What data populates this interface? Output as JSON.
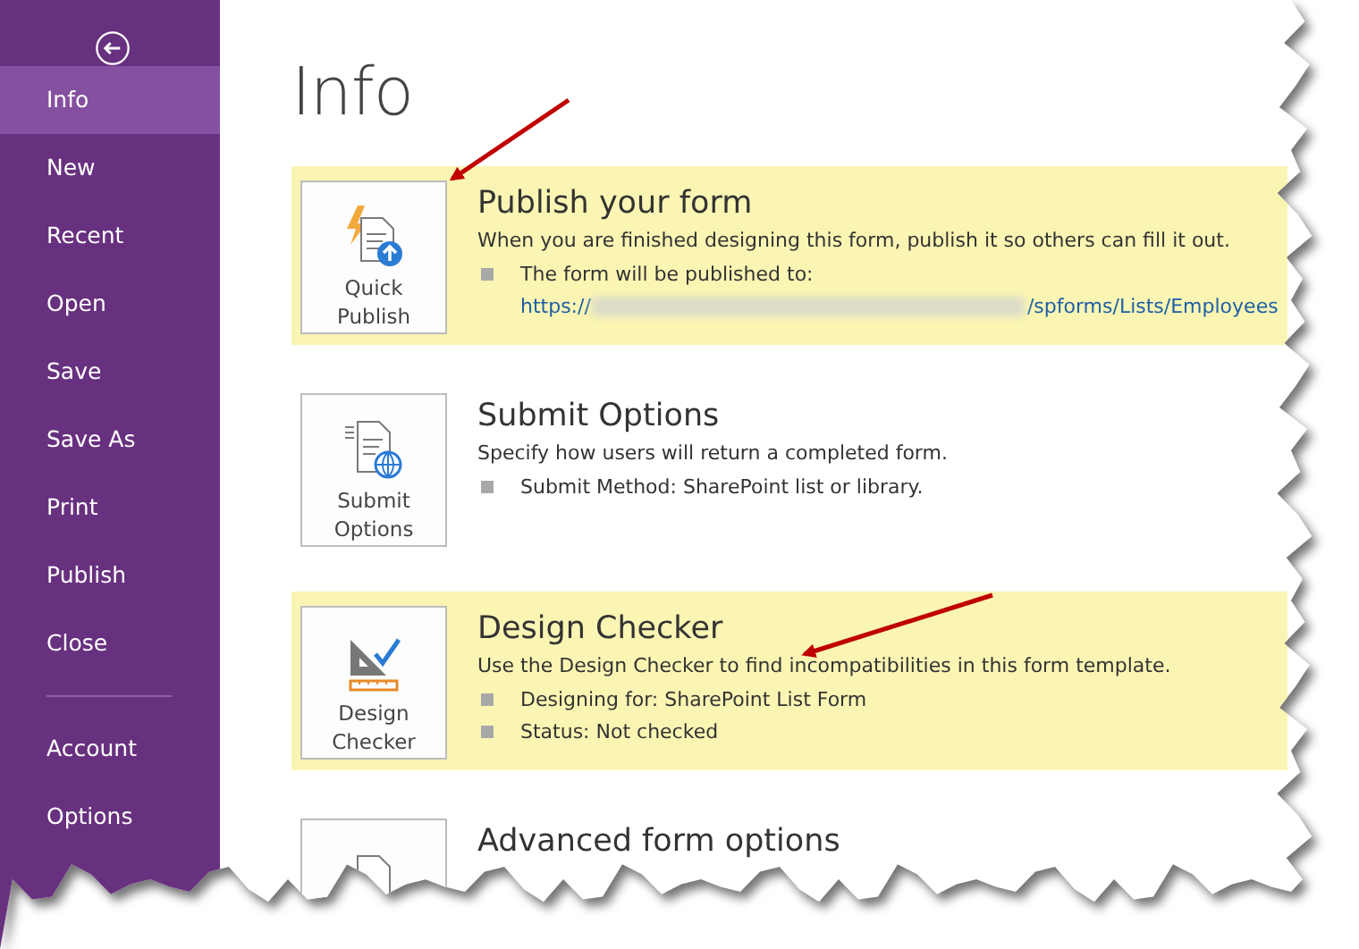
{
  "sidebar": {
    "items": [
      {
        "label": "Info",
        "selected": true
      },
      {
        "label": "New",
        "selected": false
      },
      {
        "label": "Recent",
        "selected": false
      },
      {
        "label": "Open",
        "selected": false
      },
      {
        "label": "Save",
        "selected": false
      },
      {
        "label": "Save As",
        "selected": false
      },
      {
        "label": "Print",
        "selected": false
      },
      {
        "label": "Publish",
        "selected": false
      },
      {
        "label": "Close",
        "selected": false
      },
      {
        "label": "Account",
        "selected": false,
        "kind": "bottom"
      },
      {
        "label": "Options",
        "selected": false,
        "kind": "bottom"
      }
    ]
  },
  "page_title": "Info",
  "sections": [
    {
      "kind": "publish",
      "button": [
        "Quick",
        "Publish"
      ],
      "title": "Publish your form",
      "highlighted": true,
      "description": "When you are finished designing this form, publish it so others can fill it out.",
      "bullets": [
        "The form will be published to:"
      ],
      "link": {
        "start": "https://",
        "end": "/spforms/Lists/Employees"
      }
    },
    {
      "kind": "submit",
      "button": [
        "Submit",
        "Options"
      ],
      "title": "Submit Options",
      "highlighted": false,
      "description": "Specify how users will return a completed form.",
      "bullets": [
        "Submit Method: SharePoint list or library."
      ]
    },
    {
      "kind": "checker",
      "button": [
        "Design",
        "Checker"
      ],
      "title": "Design Checker",
      "highlighted": true,
      "description": "Use the Design Checker to find incompatibilities in this form template.",
      "bullets": [
        "Designing for: SharePoint List Form",
        "Status: Not checked"
      ]
    },
    {
      "kind": "advanced",
      "title": "Advanced form options",
      "highlighted": false
    }
  ]
}
